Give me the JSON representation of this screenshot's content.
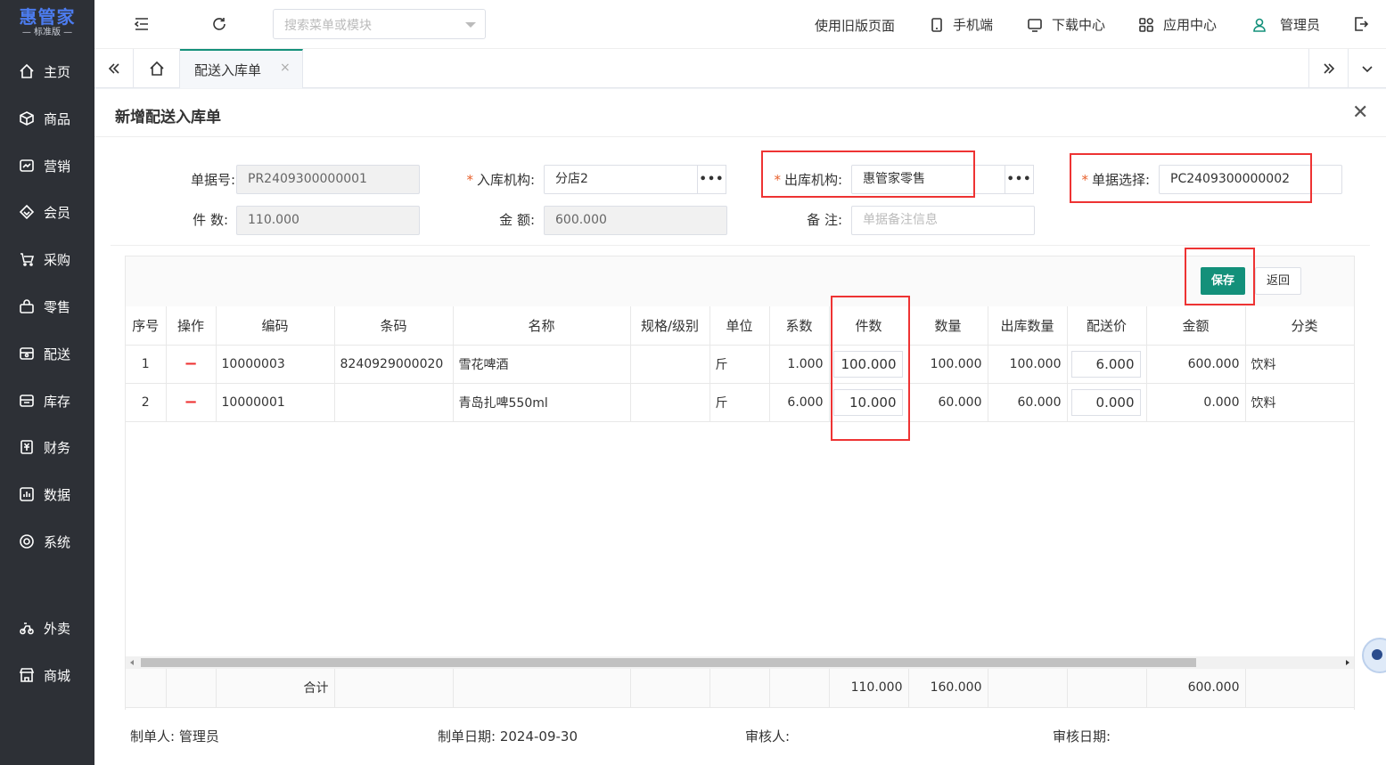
{
  "app": {
    "logo": "惠管家",
    "edition": "标准版"
  },
  "nav": [
    {
      "label": "主页",
      "icon": "home-icon"
    },
    {
      "label": "商品",
      "icon": "box-icon"
    },
    {
      "label": "营销",
      "icon": "chart-icon"
    },
    {
      "label": "会员",
      "icon": "diamond-icon"
    },
    {
      "label": "采购",
      "icon": "cart-icon"
    },
    {
      "label": "零售",
      "icon": "bag-icon"
    },
    {
      "label": "配送",
      "icon": "truck-icon"
    },
    {
      "label": "库存",
      "icon": "warehouse-icon"
    },
    {
      "label": "财务",
      "icon": "finance-icon"
    },
    {
      "label": "数据",
      "icon": "data-icon"
    },
    {
      "label": "系统",
      "icon": "gear-icon"
    },
    {
      "label": "外卖",
      "icon": "bike-icon"
    },
    {
      "label": "商城",
      "icon": "store-icon"
    }
  ],
  "header": {
    "search_placeholder": "搜索菜单或模块",
    "old_page": "使用旧版页面",
    "mobile": "手机端",
    "download": "下载中心",
    "apps": "应用中心",
    "user": "管理员"
  },
  "tabs": {
    "active": "配送入库单"
  },
  "page": {
    "title": "新增配送入库单"
  },
  "form": {
    "doc_no_label": "单据号:",
    "doc_no": "PR2409300000001",
    "in_org_label": "入库机构:",
    "in_org": "分店2",
    "out_org_label": "出库机构:",
    "out_org": "惠管家零售",
    "doc_select_label": "单据选择:",
    "doc_select": "PC2409300000002",
    "qty_label": "件 数:",
    "qty": "110.000",
    "amount_label": "金 额:",
    "amount": "600.000",
    "remark_label": "备 注:",
    "remark_placeholder": "单据备注信息"
  },
  "actions": {
    "save": "保存",
    "back": "返回"
  },
  "table": {
    "headers": [
      "序号",
      "操作",
      "编码",
      "条码",
      "名称",
      "规格/级别",
      "单位",
      "系数",
      "件数",
      "数量",
      "出库数量",
      "配送价",
      "金额",
      "分类"
    ],
    "rows": [
      {
        "no": "1",
        "op": "−",
        "code": "10000003",
        "barcode": "8240929000020",
        "name": "雪花啤酒",
        "spec": "",
        "unit": "斤",
        "factor": "1.000",
        "pieces": "100.000",
        "qty": "100.000",
        "out_qty": "100.000",
        "price": "6.000",
        "amount": "600.000",
        "category": "饮料"
      },
      {
        "no": "2",
        "op": "−",
        "code": "10000001",
        "barcode": "",
        "name": "青岛扎啤550ml",
        "spec": "",
        "unit": "斤",
        "factor": "6.000",
        "pieces": "10.000",
        "qty": "60.000",
        "out_qty": "60.000",
        "price": "0.000",
        "amount": "0.000",
        "category": "饮料"
      }
    ],
    "total_label": "合计",
    "total_pieces": "110.000",
    "total_qty": "160.000",
    "total_amount": "600.000"
  },
  "footer": {
    "creator_label": "制单人:",
    "creator": "管理员",
    "date_label": "制单日期:",
    "date": "2024-09-30",
    "reviewer_label": "审核人:",
    "reviewer": "",
    "review_date_label": "审核日期:",
    "review_date": ""
  },
  "colors": {
    "sidebar": "#2d3036",
    "primary": "#13907a",
    "logo": "#4c7cf0",
    "highlight": "#e33333"
  }
}
